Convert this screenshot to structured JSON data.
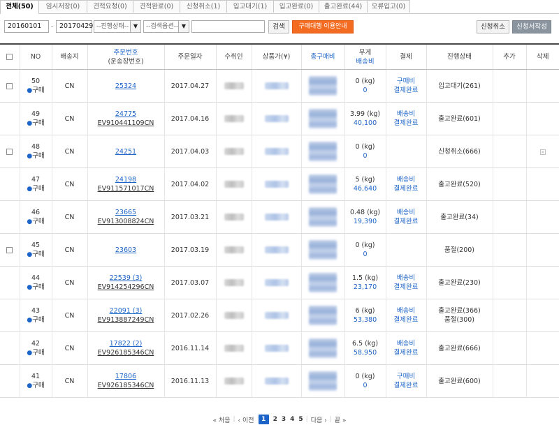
{
  "tabs": [
    {
      "label": "전체(50)",
      "active": true
    },
    {
      "label": "임시저장(0)"
    },
    {
      "label": "견적요청(0)"
    },
    {
      "label": "견적완료(0)"
    },
    {
      "label": "신청취소(1)"
    },
    {
      "label": "입고대기(1)"
    },
    {
      "label": "입고완료(0)"
    },
    {
      "label": "출고완료(44)"
    },
    {
      "label": "오류입고(0)"
    }
  ],
  "filter": {
    "date_from": "20160101",
    "date_to": "20170429",
    "dash": "-",
    "status_select": "--진행상태--",
    "option_select": "--검색옵션--",
    "search_value": "",
    "search_button": "검색",
    "guide_button": "구매대행 이용안내",
    "cancel_button": "신청취소",
    "write_button": "신청서작성"
  },
  "columns": {
    "no": "NO",
    "dest": "배송지",
    "order_no": "주문번호",
    "tracking_no": "(운송장번호)",
    "order_date": "주문일자",
    "receiver": "수취인",
    "price": "상품가(¥)",
    "total": "총구매비",
    "weight": "무게",
    "ship_fee": "배송비",
    "payment": "결제",
    "status": "진행상태",
    "add": "추가",
    "delete": "삭제"
  },
  "rows": [
    {
      "no": "50",
      "type": "구매",
      "checkbox": true,
      "dest": "CN",
      "order": "25324",
      "tracking": "",
      "date": "2017.04.27",
      "weight": "0 (kg)",
      "fee": "0",
      "pay1": "구매비",
      "pay2": "결제완료",
      "status1": "입고대기(261)",
      "status2": "",
      "del": false
    },
    {
      "no": "49",
      "type": "구매",
      "checkbox": false,
      "dest": "CN",
      "order": "24775",
      "tracking": "EV910441109CN",
      "date": "2017.04.16",
      "weight": "3.99 (kg)",
      "fee": "40,100",
      "pay1": "배송비",
      "pay2": "결제완료",
      "status1": "출고완료(601)",
      "status2": "",
      "del": false
    },
    {
      "no": "48",
      "type": "구매",
      "checkbox": true,
      "dest": "CN",
      "order": "24251",
      "tracking": "",
      "date": "2017.04.03",
      "weight": "0 (kg)",
      "fee": "0",
      "pay1": "",
      "pay2": "",
      "status1": "신청취소(666)",
      "status2": "",
      "del": true
    },
    {
      "no": "47",
      "type": "구매",
      "checkbox": false,
      "dest": "CN",
      "order": "24198",
      "tracking": "EV911571017CN",
      "date": "2017.04.02",
      "weight": "5 (kg)",
      "fee": "46,640",
      "pay1": "배송비",
      "pay2": "결제완료",
      "status1": "출고완료(520)",
      "status2": "",
      "del": false
    },
    {
      "no": "46",
      "type": "구매",
      "checkbox": false,
      "dest": "CN",
      "order": "23665",
      "tracking": "EV913008824CN",
      "date": "2017.03.21",
      "weight": "0.48 (kg)",
      "fee": "19,390",
      "pay1": "배송비",
      "pay2": "결제완료",
      "status1": "출고완료(34)",
      "status2": "",
      "del": false
    },
    {
      "no": "45",
      "type": "구매",
      "checkbox": true,
      "dest": "CN",
      "order": "23603",
      "tracking": "",
      "date": "2017.03.19",
      "weight": "0 (kg)",
      "fee": "0",
      "pay1": "",
      "pay2": "",
      "status1": "품절(200)",
      "status2": "",
      "del": false
    },
    {
      "no": "44",
      "type": "구매",
      "checkbox": false,
      "dest": "CN",
      "order": "22539 (3)",
      "tracking": "EV914254296CN",
      "date": "2017.03.07",
      "weight": "1.5 (kg)",
      "fee": "23,170",
      "pay1": "배송비",
      "pay2": "결제완료",
      "status1": "출고완료(230)",
      "status2": "",
      "del": false
    },
    {
      "no": "43",
      "type": "구매",
      "checkbox": false,
      "dest": "CN",
      "order": "22091 (3)",
      "tracking": "EV913887249CN",
      "date": "2017.02.26",
      "weight": "6 (kg)",
      "fee": "53,380",
      "pay1": "배송비",
      "pay2": "결제완료",
      "status1": "출고완료(366)",
      "status2": "품절(300)",
      "del": false
    },
    {
      "no": "42",
      "type": "구매",
      "checkbox": false,
      "dest": "CN",
      "order": "17822 (2)",
      "tracking": "EV926185346CN",
      "date": "2016.11.14",
      "weight": "6.5 (kg)",
      "fee": "58,950",
      "pay1": "배송비",
      "pay2": "결제완료",
      "status1": "출고완료(666)",
      "status2": "",
      "del": false
    },
    {
      "no": "41",
      "type": "구매",
      "checkbox": false,
      "dest": "CN",
      "order": "17806",
      "tracking": "EV926185346CN",
      "date": "2016.11.13",
      "weight": "0 (kg)",
      "fee": "0",
      "pay1": "구매비",
      "pay2": "결제완료",
      "status1": "출고완료(600)",
      "status2": "",
      "del": false
    }
  ],
  "pager": {
    "first": "« 처음",
    "prev": "‹ 이전",
    "pages": [
      "1",
      "2",
      "3",
      "4",
      "5"
    ],
    "current": "1",
    "next": "다음 ›",
    "last": "끝 »"
  }
}
